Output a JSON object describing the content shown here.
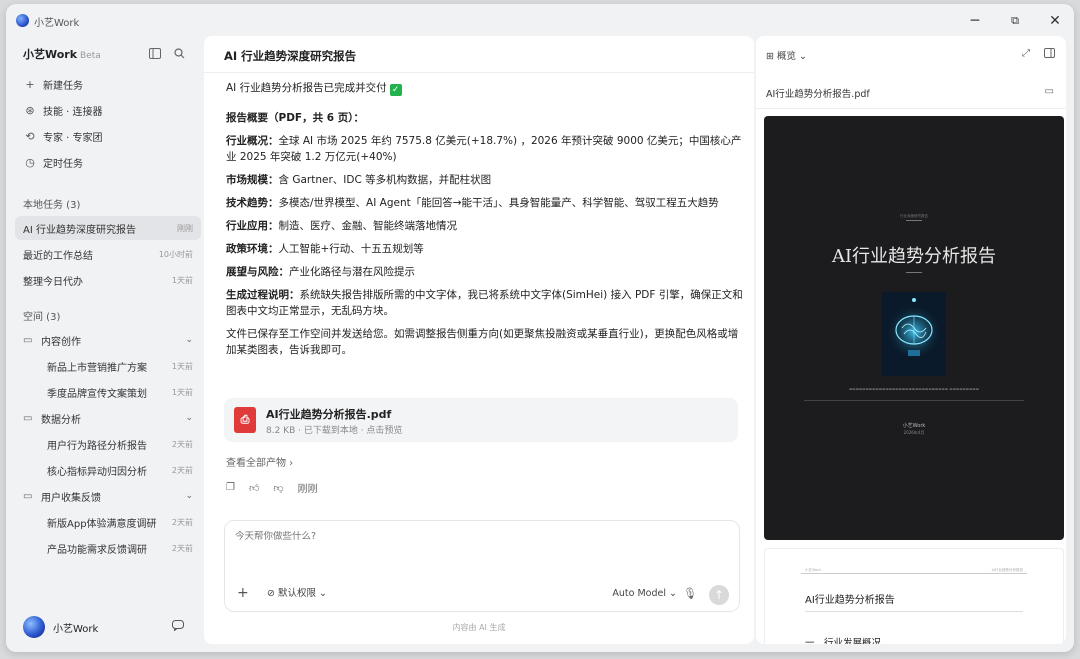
{
  "app": {
    "title": "小艺Work"
  },
  "window_controls": {
    "minimize": "─",
    "restore": "⧉",
    "close": "✕"
  },
  "sidebar": {
    "brand": "小艺Work",
    "beta": "Beta",
    "menu": [
      {
        "icon": "+",
        "label": "新建任务"
      },
      {
        "icon": "⊛",
        "label": "技能 · 连接器"
      },
      {
        "icon": "⟲",
        "label": "专家 · 专家团"
      },
      {
        "icon": "◷",
        "label": "定时任务"
      }
    ],
    "local_tasks_title": "本地任务 (3)",
    "local_tasks": [
      {
        "label": "AI 行业趋势深度研究报告",
        "time": "刚刚"
      },
      {
        "label": "最近的工作总结",
        "time": "10小时前"
      },
      {
        "label": "整理今日代办",
        "time": "1天前"
      }
    ],
    "spaces_title": "空间 (3)",
    "folders": [
      {
        "label": "内容创作",
        "items": [
          {
            "label": "新品上市营销推广方案",
            "time": "1天前"
          },
          {
            "label": "季度品牌宣传文案策划",
            "time": "1天前"
          }
        ]
      },
      {
        "label": "数据分析",
        "items": [
          {
            "label": "用户行为路径分析报告",
            "time": "2天前"
          },
          {
            "label": "核心指标异动归因分析",
            "time": "2天前"
          }
        ]
      },
      {
        "label": "用户收集反馈",
        "items": [
          {
            "label": "新版App体验满意度调研",
            "time": "2天前"
          },
          {
            "label": "产品功能需求反馈调研",
            "time": "2天前"
          }
        ]
      }
    ],
    "user_name": "小艺Work"
  },
  "main": {
    "title": "AI 行业趋势深度研究报告",
    "intro": "AI 行业趋势分析报告已完成并交付",
    "overview": "报告概要（PDF，共 6 页）：",
    "items": [
      {
        "k": "行业概况：",
        "v": "全球 AI 市场 2025 年约 7575.8 亿美元(+18.7%) ，2026 年预计突破 9000 亿美元；中国核心产业 2025 年突破 1.2 万亿元(+40%)"
      },
      {
        "k": "市场规模：",
        "v": "含 Gartner、IDC 等多机构数据，并配柱状图"
      },
      {
        "k": "技术趋势：",
        "v": "多模态/世界模型、AI Agent「能回答→能干活」、具身智能量产、科学智能、驾驭工程五大趋势"
      },
      {
        "k": "行业应用：",
        "v": "制造、医疗、金融、智能终端落地情况"
      },
      {
        "k": "政策环境：",
        "v": "人工智能+行动、十五五规划等"
      },
      {
        "k": "展望与风险：",
        "v": "产业化路径与潜在风险提示"
      },
      {
        "k": "生成过程说明：",
        "v": "系统缺失报告排版所需的中文字体，我已将系统中文字体(SimHei) 接入 PDF 引擎，确保正文和图表中文均正常显示，无乱码方块。"
      }
    ],
    "closing": "文件已保存至工作空间并发送给您。如需调整报告侧重方向(如更聚焦投融资或某垂直行业)，更换配色风格或增加某类图表，告诉我即可。",
    "file": {
      "name": "AI行业趋势分析报告.pdf",
      "meta": "8.2 KB · 已下载到本地 · 点击预览"
    },
    "view_all": "查看全部产物 ›",
    "action_time": "刚刚",
    "input": {
      "placeholder": "今天帮你做些什么?",
      "permission": "默认权限",
      "model": "Auto Model"
    },
    "footnote": "内容由 AI 生成"
  },
  "preview": {
    "mode": "概览",
    "file_name": "AI行业趋势分析报告.pdf",
    "cover": {
      "kicker": "行业深度研究报告",
      "title": "AI行业趋势分析报告",
      "brand": "小艺Work",
      "date": "2026年4月"
    },
    "page2": {
      "header_left": "小艺Work",
      "header_right": "AI行业趋势分析报告",
      "title": "AI行业趋势分析报告",
      "section": "一、行业发展概况"
    }
  },
  "colors": {
    "accent": "#2d58d0",
    "pdf": "#e03a3a",
    "check": "#22b14c",
    "cover_bg": "#1c1c1e"
  }
}
